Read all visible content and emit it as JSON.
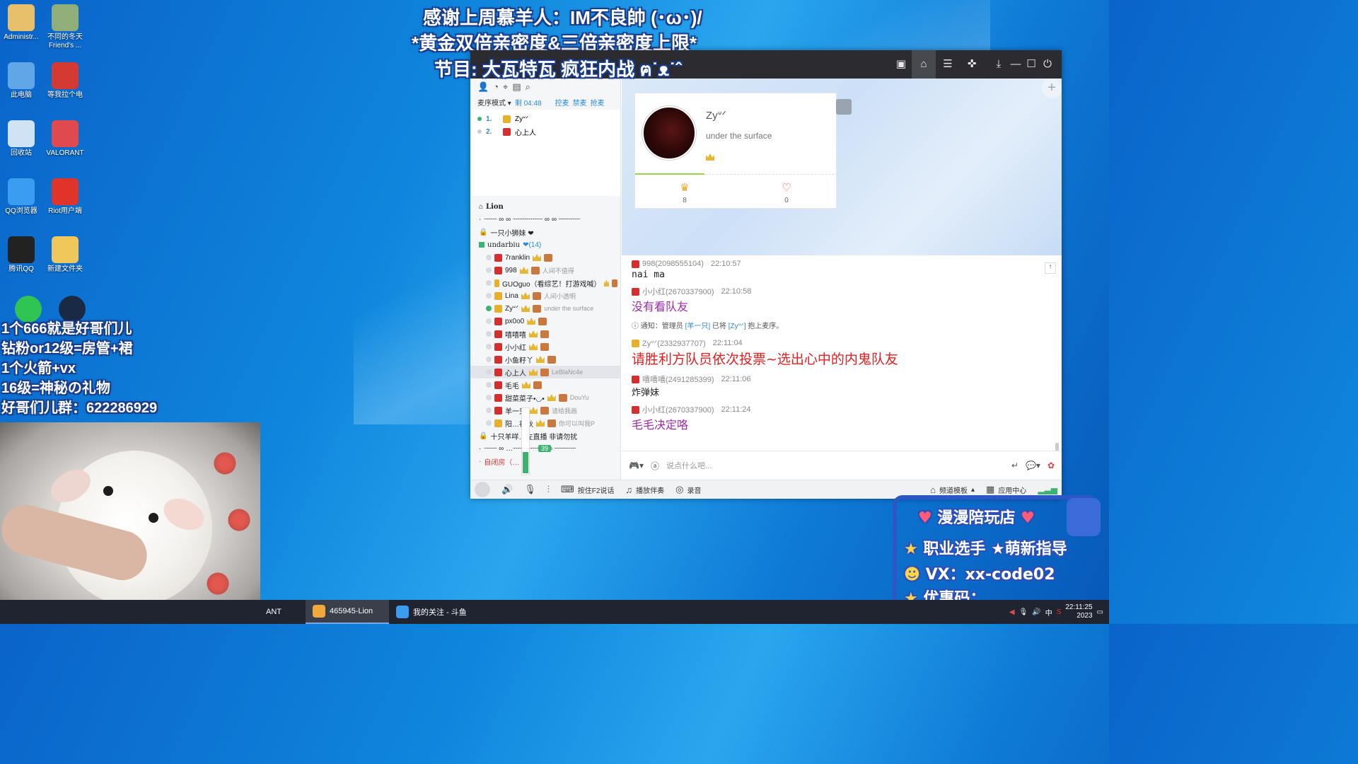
{
  "desktop": {
    "icons": [
      {
        "label": "Administr...",
        "icon": "user-folder-icon",
        "color": "#e8c069"
      },
      {
        "label": "不同的冬天 Friend's ...",
        "icon": "game-icon",
        "color": "#8fae7a"
      },
      {
        "label": "此电脑",
        "icon": "computer-icon",
        "color": "#5fa7e6"
      },
      {
        "label": "等我拉个电",
        "icon": "apex-icon",
        "color": "#d43a32"
      },
      {
        "label": "回收站",
        "icon": "recycle-bin-icon",
        "color": "#cfe3f5"
      },
      {
        "label": "VALORANT",
        "icon": "valorant-icon",
        "color": "#e04a4f"
      },
      {
        "label": "QQ浏览器",
        "icon": "qq-browser-icon",
        "color": "#3b9df0"
      },
      {
        "label": "Riot用户端",
        "icon": "riot-icon",
        "color": "#e0342b"
      },
      {
        "label": "腾讯QQ",
        "icon": "qq-penguin-icon",
        "color": "#222222"
      },
      {
        "label": "新建文件夹",
        "icon": "folder-icon",
        "color": "#f0c75a"
      }
    ]
  },
  "overlay": {
    "top_lines": [
      "感谢上周慕羊人：IM不良帥 (･ω･)/",
      "*黄金双倍亲密度&三倍亲密度上限*",
      "节目: 大瓦特瓦 疯狂内战 ฅ˙ᴥ˙ˆ"
    ],
    "left_lines": [
      "1个666就是好哥们儿",
      "钻粉or12级=房管+裙",
      "1个火箭+vx",
      "16级=神秘の礼物",
      "好哥们儿群：622286929"
    ]
  },
  "app": {
    "mode_label": "麦序模式",
    "countdown": "剩 04:48",
    "mode_links": [
      "控麦",
      "禁麦",
      "抢麦"
    ],
    "queue": [
      {
        "num": "1.",
        "name": "Zyᐡᐟ"
      },
      {
        "num": "2.",
        "name": "心上人"
      }
    ],
    "channels": [
      {
        "name": "Lion"
      },
      {
        "name": "┈┈┈ ∞ ∞ ┈┈┈┈┈┈┈ ∞ ∞ ┈┈┈┈┈"
      },
      {
        "name": "一只小狮妹 ❤"
      },
      {
        "name": "undarbiu",
        "count": "❤(14)"
      }
    ],
    "members": [
      {
        "name": "7ranklin",
        "status": "",
        "online": false
      },
      {
        "name": "998",
        "status": "人间不值得",
        "online": false
      },
      {
        "name": "GUOguo（看综艺！打游戏喊）",
        "status": "",
        "online": false
      },
      {
        "name": "Lina",
        "status": "人间小透明",
        "online": false
      },
      {
        "name": "Zyᐡᐟ",
        "status": "under the surface",
        "online": true
      },
      {
        "name": "px0o0",
        "status": "",
        "online": false
      },
      {
        "name": "嘻嘻嘻",
        "status": "",
        "online": false
      },
      {
        "name": "小小红",
        "status": "",
        "online": false
      },
      {
        "name": "小鱼籽丫",
        "status": "",
        "online": false
      },
      {
        "name": "心上人",
        "status": "LeBlaNc4e",
        "online": false
      },
      {
        "name": "毛毛",
        "status": "",
        "online": false
      },
      {
        "name": "甜菜菜子•◡•",
        "status": "DouYu",
        "online": false
      },
      {
        "name": "羊一只",
        "status": "请给我画",
        "online": false
      },
      {
        "name": "阳…初秋",
        "status": "你可以叫我P",
        "online": false
      }
    ],
    "after_channels": [
      {
        "name": "十只羊咩…左直播 非请勿扰"
      },
      {
        "name": "┈┈┈ ∞ …┈┈┈┈┈┈ ∞ ∞ ┈┈┈┈┈"
      },
      {
        "name": "自闭房（…"
      }
    ],
    "volume_level": "39",
    "profile": {
      "name": "Zyᐡᐟ",
      "signature": "under the surface",
      "stat_left": "8",
      "stat_right": "0"
    },
    "chat": [
      {
        "user": "998(2098555104)",
        "time": "22:10:57",
        "text": "nai ma",
        "style": "plain"
      },
      {
        "user": "小小红(2670337900)",
        "time": "22:10:58",
        "text": "没有看队友",
        "style": "purple"
      },
      {
        "user": "Zyᐡᐟ(2332937707)",
        "time": "22:11:04",
        "text": "请胜利方队员依次投票~选出心中的内鬼队友",
        "style": "red"
      },
      {
        "user": "嘻嘻嘻(2491285399)",
        "time": "22:11:06",
        "text": "炸弹妹",
        "style": "plain"
      },
      {
        "user": "小小红(2670337900)",
        "time": "22:11:24",
        "text": "毛毛决定咯",
        "style": "purple"
      }
    ],
    "notice": {
      "prefix": "通知：管理员",
      "admin": "[羊一只]",
      "mid": "已将",
      "target": "[Zyᐡᐟ]",
      "suffix": "抱上麦序。"
    },
    "input_placeholder": "说点什么吧...",
    "bottom": {
      "ptt": "按住F2说话",
      "music": "播放伴奏",
      "record": "录音",
      "template": "频道模板",
      "appcenter": "应用中心"
    }
  },
  "taskbar": {
    "items": [
      {
        "label": "ANT",
        "icon": "valorant-task-icon",
        "active": false
      },
      {
        "label": "465945-Lion",
        "icon": "yy-owl-icon",
        "active": true
      },
      {
        "label": "我的关注 - 斗鱼",
        "icon": "qq-browser-task-icon",
        "active": false
      }
    ],
    "ime": "中",
    "time": "22:11:25",
    "date": "2023"
  },
  "promo": {
    "title": "漫漫陪玩店",
    "line2": "职业选手 ★萌新指导",
    "line3": "VX：xx-code02",
    "line4": "优惠码："
  }
}
